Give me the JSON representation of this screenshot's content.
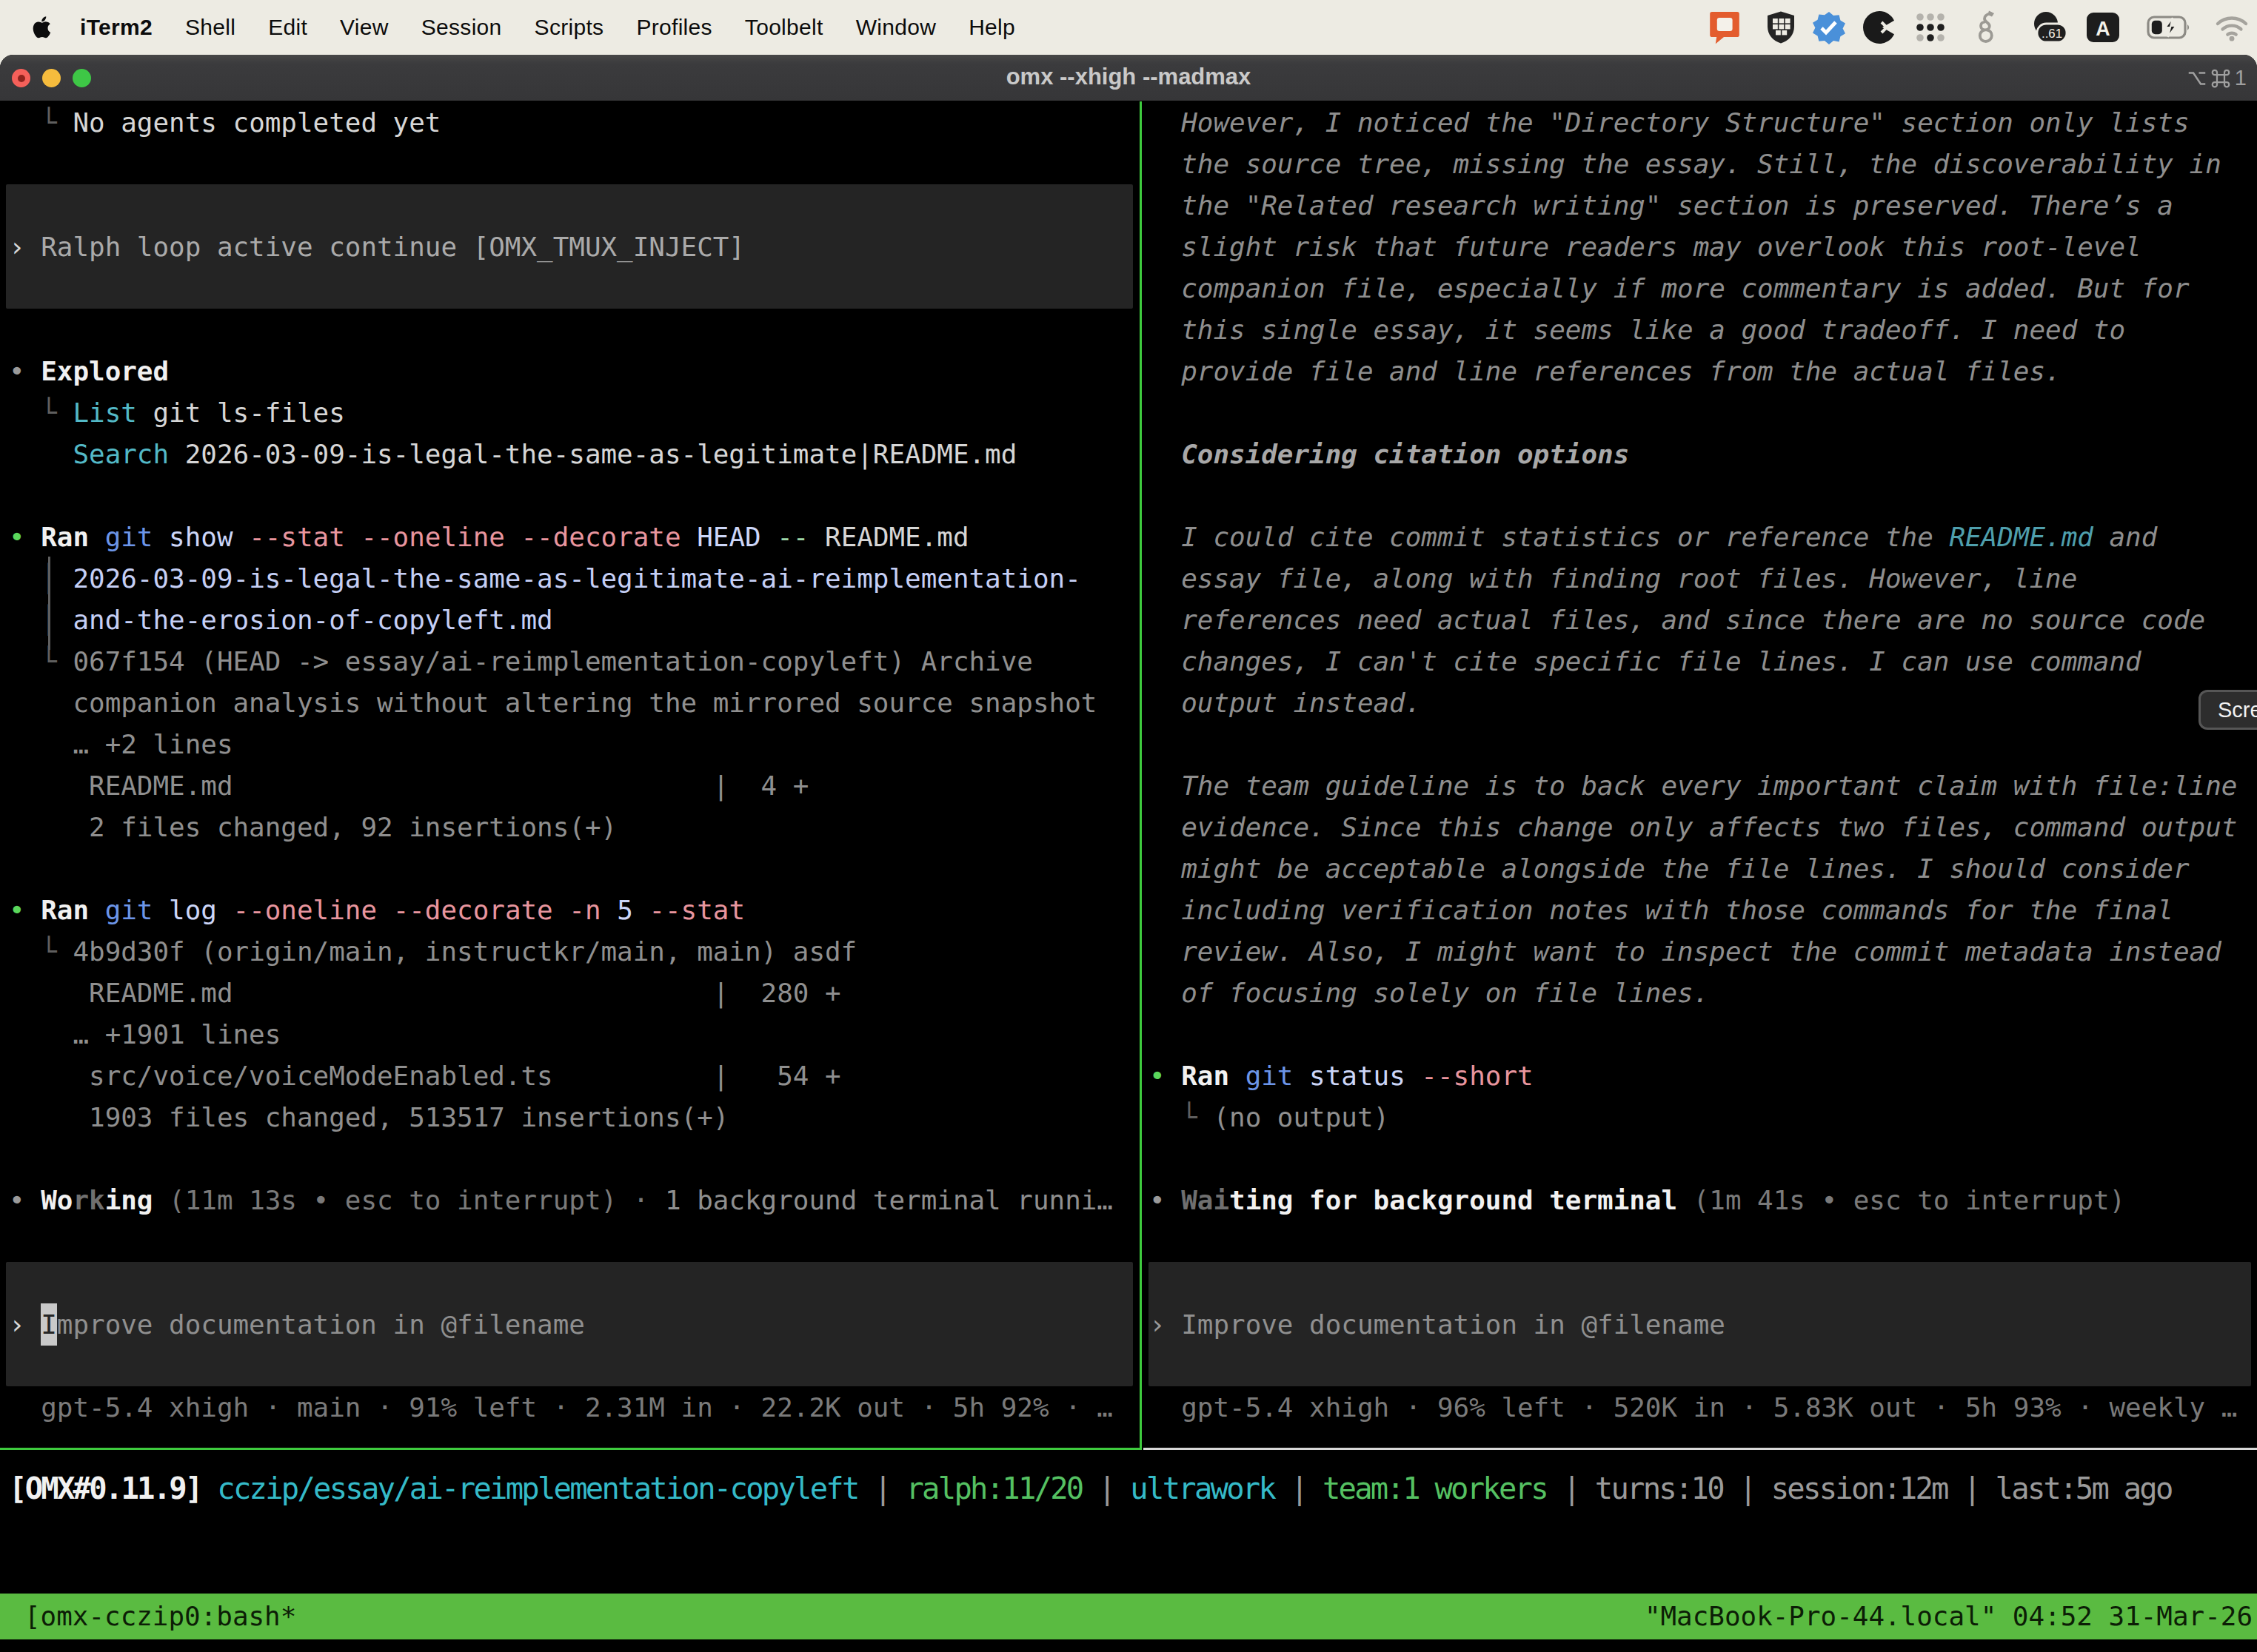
{
  "menu_bar": {
    "app_name": "iTerm2",
    "items": [
      "Shell",
      "Edit",
      "View",
      "Session",
      "Scripts",
      "Profiles",
      "Toolbelt",
      "Window",
      "Help"
    ],
    "status_icons": [
      "chat-app-icon",
      "shield-grid-icon",
      "blue-badge-icon",
      "pac-circle-icon",
      "dots-grid-icon",
      "dragon-icon",
      "count-badge-icon",
      "input-source-icon",
      "battery-charging-icon",
      "wifi-icon"
    ],
    "count_badge": "..61",
    "input_source_letter": "A"
  },
  "window": {
    "title": "omx --xhigh --madmax",
    "shortcut_number": "1"
  },
  "overlay_button_label": "Scre",
  "colors": {
    "w": "#d6d6d6",
    "b": "#f1f1f1",
    "dim": "#8f8f8f",
    "dim2": "#7a7a7a",
    "tree": "#5f5f5f",
    "grn": "#5bd75b",
    "gry": "#9a9a9a",
    "blu": "#6c95e8",
    "lav": "#ccd6f8",
    "arg": "#c5cff5",
    "pnk": "#e8959e",
    "sep": "#9fd6a9",
    "itl": "#8e8e8e",
    "bitl": "#a8a8a8",
    "cyn": "#53b9c7",
    "cyn2": "#35bac8",
    "tcyn": "#4f9fad",
    "shim": "#6f6f6f",
    "boxtext": "#aaaaaa",
    "prompt": "#d8d8d8",
    "curbg": "#c9c9c9",
    "curfg": "#262626",
    "g2": "#55c162",
    "box_bg": "#242424",
    "divider_green": "#3ecb3e",
    "border_gray": "#d8d8d8",
    "tmux_green": "#5abb41",
    "tmux_text": "#0c1e06"
  },
  "left_pane": {
    "rows": [
      {
        "n": 0,
        "seg": [
          [
            "tree",
            "  └ "
          ],
          [
            "w",
            "No agents completed yet"
          ]
        ]
      },
      {
        "n": 3,
        "seg": [
          [
            "prompt",
            "› "
          ],
          [
            "boxtext",
            "Ralph loop active continue [OMX_TMUX_INJECT]"
          ]
        ]
      },
      {
        "n": 6,
        "seg": [
          [
            "gry",
            "• "
          ],
          [
            "b",
            "Explored"
          ]
        ]
      },
      {
        "n": 7,
        "seg": [
          [
            "tree",
            "  └ "
          ],
          [
            "cyn",
            "List"
          ],
          [
            "w",
            " git ls-files"
          ]
        ]
      },
      {
        "n": 8,
        "seg": [
          [
            "w",
            "    "
          ],
          [
            "cyn",
            "Search"
          ],
          [
            "w",
            " 2026-03-09-is-legal-the-same-as-legitimate|README.md"
          ]
        ]
      },
      {
        "n": 10,
        "seg": [
          [
            "grn",
            "• "
          ],
          [
            "b",
            "Ran"
          ],
          [
            "w",
            " "
          ],
          [
            "blu",
            "git"
          ],
          [
            "w",
            " "
          ],
          [
            "lav",
            "show"
          ],
          [
            "w",
            " "
          ],
          [
            "pnk",
            "--stat"
          ],
          [
            "w",
            " "
          ],
          [
            "pnk",
            "--oneline"
          ],
          [
            "w",
            " "
          ],
          [
            "pnk",
            "--decorate"
          ],
          [
            "w",
            " "
          ],
          [
            "lav",
            "HEAD"
          ],
          [
            "w",
            " "
          ],
          [
            "sep",
            "--"
          ],
          [
            "w",
            " "
          ],
          [
            "w",
            "README.md"
          ]
        ]
      },
      {
        "n": 11,
        "seg": [
          [
            "tree",
            "  │ "
          ],
          [
            "arg",
            "2026-03-09-is-legal-the-same-as-legitimate-ai-reimplementation-"
          ]
        ]
      },
      {
        "n": 12,
        "seg": [
          [
            "tree",
            "  │ "
          ],
          [
            "arg",
            "and-the-erosion-of-copyleft.md"
          ]
        ]
      },
      {
        "n": 13,
        "seg": [
          [
            "tree",
            "  └ "
          ],
          [
            "dim",
            "067f154 (HEAD -> essay/ai-reimplementation-copyleft) Archive"
          ]
        ]
      },
      {
        "n": 14,
        "seg": [
          [
            "dim",
            "    companion analysis without altering the mirrored source snapshot"
          ]
        ]
      },
      {
        "n": 15,
        "seg": [
          [
            "dim",
            "    … +2 lines"
          ]
        ]
      },
      {
        "n": 16,
        "seg": [
          [
            "dim",
            "     README.md                              |  4 +"
          ]
        ]
      },
      {
        "n": 17,
        "seg": [
          [
            "dim",
            "     2 files changed, 92 insertions(+)"
          ]
        ]
      },
      {
        "n": 19,
        "seg": [
          [
            "grn",
            "• "
          ],
          [
            "b",
            "Ran"
          ],
          [
            "w",
            " "
          ],
          [
            "blu",
            "git"
          ],
          [
            "w",
            " "
          ],
          [
            "lav",
            "log"
          ],
          [
            "w",
            " "
          ],
          [
            "pnk",
            "--oneline"
          ],
          [
            "w",
            " "
          ],
          [
            "pnk",
            "--decorate"
          ],
          [
            "w",
            " "
          ],
          [
            "pnk",
            "-n"
          ],
          [
            "w",
            " "
          ],
          [
            "lav",
            "5"
          ],
          [
            "w",
            " "
          ],
          [
            "pnk",
            "--stat"
          ]
        ]
      },
      {
        "n": 20,
        "seg": [
          [
            "tree",
            "  └ "
          ],
          [
            "dim",
            "4b9d30f (origin/main, instructkr/main, main) asdf"
          ]
        ]
      },
      {
        "n": 21,
        "seg": [
          [
            "dim",
            "     README.md                              |  280 +"
          ]
        ]
      },
      {
        "n": 22,
        "seg": [
          [
            "dim",
            "    … +1901 lines"
          ]
        ]
      },
      {
        "n": 23,
        "seg": [
          [
            "dim",
            "     src/voice/voiceModeEnabled.ts          |   54 +"
          ]
        ]
      },
      {
        "n": 24,
        "seg": [
          [
            "dim",
            "     1903 files changed, 513517 insertions(+)"
          ]
        ]
      },
      {
        "n": 26,
        "seg": [
          [
            "gry",
            "• "
          ],
          [
            "b",
            "Wo"
          ],
          [
            "shim b",
            "rk"
          ],
          [
            "b",
            "ing"
          ],
          [
            "dim2",
            " (11m 13s • esc to interrupt) · "
          ],
          [
            "dim",
            "1 background terminal runni…"
          ]
        ]
      },
      {
        "n": 29,
        "seg": [
          [
            "prompt",
            "› "
          ],
          [
            "cur",
            "I"
          ],
          [
            "dim",
            "mprove documentation in @filename"
          ]
        ]
      },
      {
        "n": 31,
        "seg": [
          [
            "dim2",
            "  gpt-5.4 xhigh · main · 91% left · 2.31M in · 22.2K out · 5h 92% · …"
          ]
        ]
      }
    ],
    "boxes": [
      {
        "top_row": 2,
        "rows": 3,
        "kind": "message"
      },
      {
        "top_row": 28,
        "rows": 3,
        "kind": "input"
      }
    ]
  },
  "right_pane": {
    "rows": [
      {
        "n": 0,
        "seg": [
          [
            "itl",
            "  However, I noticed the \"Directory Structure\" section only lists"
          ]
        ]
      },
      {
        "n": 1,
        "seg": [
          [
            "itl",
            "  the source tree, missing the essay. Still, the discoverability in"
          ]
        ]
      },
      {
        "n": 2,
        "seg": [
          [
            "itl",
            "  the \"Related research writing\" section is preserved. There’s a"
          ]
        ]
      },
      {
        "n": 3,
        "seg": [
          [
            "itl",
            "  slight risk that future readers may overlook this root-level"
          ]
        ]
      },
      {
        "n": 4,
        "seg": [
          [
            "itl",
            "  companion file, especially if more commentary is added. But for"
          ]
        ]
      },
      {
        "n": 5,
        "seg": [
          [
            "itl",
            "  this single essay, it seems like a good tradeoff. I need to"
          ]
        ]
      },
      {
        "n": 6,
        "seg": [
          [
            "itl",
            "  provide file and line references from the actual files."
          ]
        ]
      },
      {
        "n": 8,
        "seg": [
          [
            "bitl",
            "  Considering citation options"
          ]
        ]
      },
      {
        "n": 10,
        "seg": [
          [
            "itl",
            "  I could cite commit statistics or reference the "
          ],
          [
            "tcyn itl",
            "README.md"
          ],
          [
            "itl",
            " and"
          ]
        ]
      },
      {
        "n": 11,
        "seg": [
          [
            "itl",
            "  essay file, along with finding root files. However, line"
          ]
        ]
      },
      {
        "n": 12,
        "seg": [
          [
            "itl",
            "  references need actual files, and since there are no source code"
          ]
        ]
      },
      {
        "n": 13,
        "seg": [
          [
            "itl",
            "  changes, I can't cite specific file lines. I can use command"
          ]
        ]
      },
      {
        "n": 14,
        "seg": [
          [
            "itl",
            "  output instead."
          ]
        ]
      },
      {
        "n": 16,
        "seg": [
          [
            "itl",
            "  The team guideline is to back every important claim with file:line"
          ]
        ]
      },
      {
        "n": 17,
        "seg": [
          [
            "itl",
            "  evidence. Since this change only affects two files, command output"
          ]
        ]
      },
      {
        "n": 18,
        "seg": [
          [
            "itl",
            "  might be acceptable alongside the file lines. I should consider"
          ]
        ]
      },
      {
        "n": 19,
        "seg": [
          [
            "itl",
            "  including verification notes with those commands for the final"
          ]
        ]
      },
      {
        "n": 20,
        "seg": [
          [
            "itl",
            "  review. Also, I might want to inspect the commit metadata instead"
          ]
        ]
      },
      {
        "n": 21,
        "seg": [
          [
            "itl",
            "  of focusing solely on file lines."
          ]
        ]
      },
      {
        "n": 23,
        "seg": [
          [
            "grn",
            "• "
          ],
          [
            "b",
            "Ran"
          ],
          [
            "w",
            " "
          ],
          [
            "blu",
            "git"
          ],
          [
            "w",
            " "
          ],
          [
            "lav",
            "status"
          ],
          [
            "w",
            " "
          ],
          [
            "pnk",
            "--short"
          ]
        ]
      },
      {
        "n": 24,
        "seg": [
          [
            "tree",
            "  └ "
          ],
          [
            "dim",
            "(no output)"
          ]
        ]
      },
      {
        "n": 26,
        "seg": [
          [
            "gry",
            "• "
          ],
          [
            "shim b",
            "Wai"
          ],
          [
            "b",
            "ting for background terminal"
          ],
          [
            "dim2",
            " (1m 41s • esc to interrupt)"
          ]
        ]
      },
      {
        "n": 29,
        "seg": [
          [
            "gry",
            "› "
          ],
          [
            "dim",
            "Improve documentation in @filename"
          ]
        ]
      },
      {
        "n": 31,
        "seg": [
          [
            "dim2",
            "  gpt-5.4 xhigh · 96% left · 520K in · 5.83K out · 5h 93% · weekly …"
          ]
        ]
      }
    ],
    "boxes": [
      {
        "top_row": 28,
        "rows": 3,
        "kind": "input"
      }
    ]
  },
  "omx_status": {
    "seg": [
      [
        "b",
        "[OMX#0.11.9]"
      ],
      [
        "w",
        " "
      ],
      [
        "cyn2",
        "cczip/essay/ai-reimplementation-copyleft"
      ],
      [
        "gry",
        " | "
      ],
      [
        "g2",
        "ralph:11/20"
      ],
      [
        "gry",
        " | "
      ],
      [
        "cyn2",
        "ultrawork"
      ],
      [
        "gry",
        " | "
      ],
      [
        "g2",
        "team:1 workers"
      ],
      [
        "gry",
        " | "
      ],
      [
        "gry",
        "turns:10"
      ],
      [
        "gry",
        " | "
      ],
      [
        "gry",
        "session:12m"
      ],
      [
        "gry",
        " | "
      ],
      [
        "gry",
        "last:5m ago"
      ]
    ]
  },
  "tmux_bar": {
    "left": "[omx-cczip0:bash*",
    "right": "\"MacBook-Pro-44.local\" 04:52 31-Mar-26"
  }
}
